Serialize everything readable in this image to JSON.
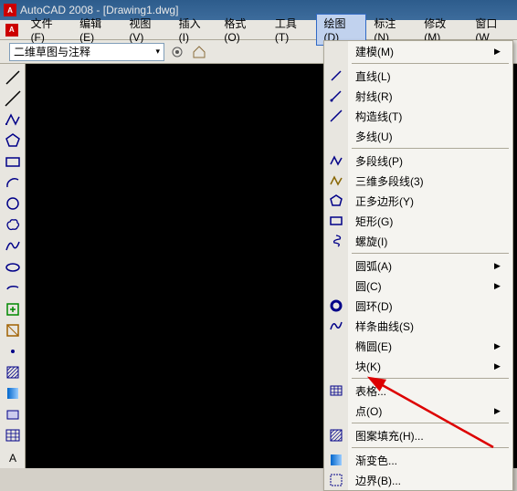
{
  "titlebar": {
    "app_name": "AutoCAD 2008",
    "doc": "[Drawing1.dwg]"
  },
  "menubar": {
    "items": [
      {
        "label": "文件(F)"
      },
      {
        "label": "编辑(E)"
      },
      {
        "label": "视图(V)"
      },
      {
        "label": "插入(I)"
      },
      {
        "label": "格式(O)"
      },
      {
        "label": "工具(T)"
      },
      {
        "label": "绘图(D)",
        "active": true
      },
      {
        "label": "标注(N)"
      },
      {
        "label": "修改(M)"
      },
      {
        "label": "窗口(W"
      }
    ]
  },
  "toolbar": {
    "workspace_dropdown": "二维草图与注释"
  },
  "left_tools": [
    "line",
    "construction-line",
    "polyline",
    "polygon",
    "rectangle",
    "arc",
    "circle",
    "revision-cloud",
    "spline",
    "ellipse",
    "ellipse-arc",
    "insert-block",
    "make-block",
    "point",
    "hatch",
    "gradient",
    "region",
    "table",
    "text"
  ],
  "draw_menu": {
    "groups": [
      [
        {
          "label": "建模(M)",
          "submenu": true,
          "icon": null
        }
      ],
      [
        {
          "label": "直线(L)",
          "icon": "line"
        },
        {
          "label": "射线(R)",
          "icon": "ray"
        },
        {
          "label": "构造线(T)",
          "icon": "xline"
        },
        {
          "label": "多线(U)",
          "icon": null
        }
      ],
      [
        {
          "label": "多段线(P)",
          "icon": "polyline"
        },
        {
          "label": "三维多段线(3)",
          "icon": "3dpoly"
        },
        {
          "label": "正多边形(Y)",
          "icon": "polygon"
        },
        {
          "label": "矩形(G)",
          "icon": "rectangle"
        },
        {
          "label": "螺旋(I)",
          "icon": "helix"
        }
      ],
      [
        {
          "label": "圆弧(A)",
          "submenu": true,
          "icon": null
        },
        {
          "label": "圆(C)",
          "submenu": true,
          "icon": null
        },
        {
          "label": "圆环(D)",
          "icon": "donut"
        },
        {
          "label": "样条曲线(S)",
          "icon": "spline"
        },
        {
          "label": "椭圆(E)",
          "submenu": true,
          "icon": null
        },
        {
          "label": "块(K)",
          "submenu": true,
          "icon": null
        }
      ],
      [
        {
          "label": "表格...",
          "icon": "table"
        },
        {
          "label": "点(O)",
          "submenu": true,
          "icon": null
        }
      ],
      [
        {
          "label": "图案填充(H)...",
          "icon": "hatch"
        }
      ],
      [
        {
          "label": "渐变色...",
          "icon": "gradient"
        },
        {
          "label": "边界(B)...",
          "icon": "boundary"
        }
      ]
    ]
  }
}
